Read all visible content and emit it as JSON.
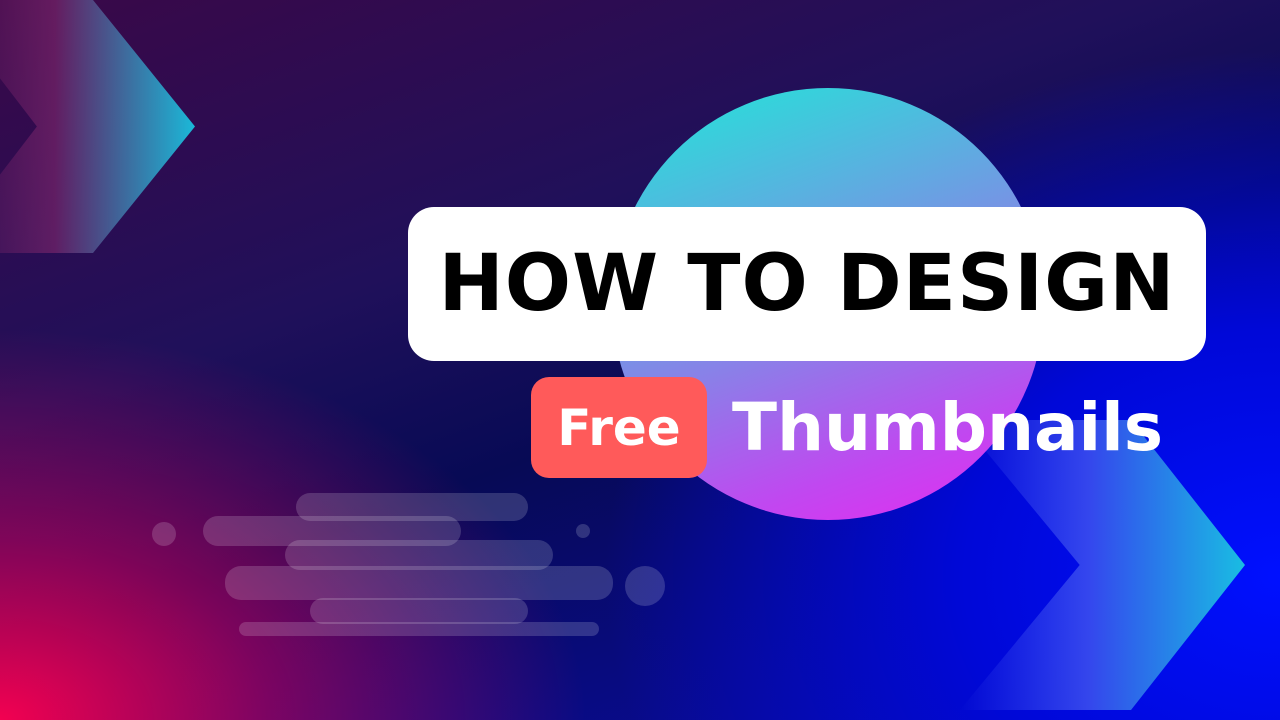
{
  "title": {
    "text": "HOW TO DESIGN"
  },
  "badge": {
    "text": "Free"
  },
  "subtitle": {
    "text": "Thumbnails"
  },
  "colors": {
    "title_box": "#ffffff",
    "badge": "#ff5a5a",
    "text_light": "#ffffff",
    "text_dark": "#000000",
    "circle_top": "#1ee8d8",
    "circle_bottom": "#e828f0",
    "arrow_accent": "#1bb8d8"
  }
}
